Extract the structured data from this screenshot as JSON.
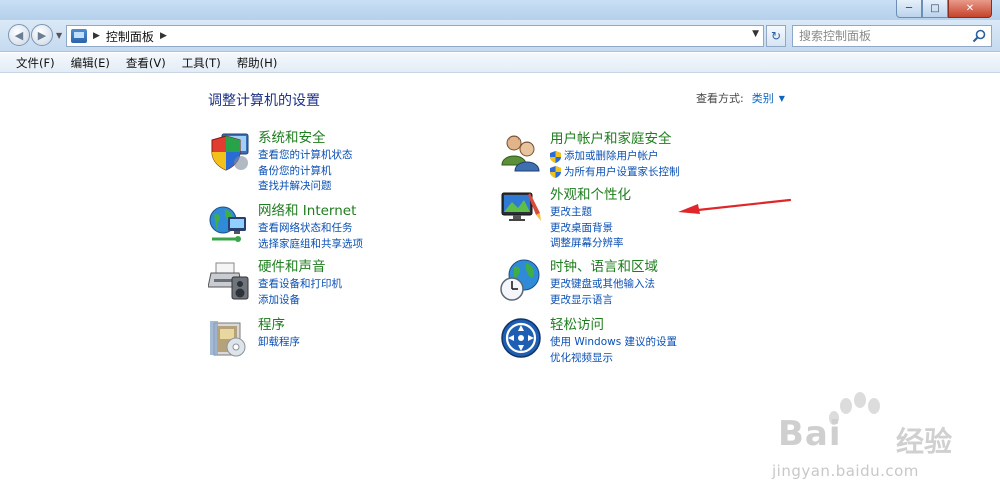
{
  "window": {
    "controls": [
      "minimize-icon",
      "restore-icon",
      "close-icon"
    ]
  },
  "address": {
    "path": "控制面板",
    "search_placeholder": "搜索控制面板"
  },
  "menu": [
    "文件(F)",
    "编辑(E)",
    "查看(V)",
    "工具(T)",
    "帮助(H)"
  ],
  "main": {
    "title": "调整计算机的设置",
    "view_by_label": "查看方式:",
    "view_by_value": "类别"
  },
  "categories_left": [
    {
      "title": "系统和安全",
      "icon": "shield-computer-icon",
      "links": [
        "查看您的计算机状态",
        "备份您的计算机",
        "查找并解决问题"
      ]
    },
    {
      "title": "网络和 Internet",
      "icon": "network-globe-icon",
      "links": [
        "查看网络状态和任务",
        "选择家庭组和共享选项"
      ]
    },
    {
      "title": "硬件和声音",
      "icon": "printer-speaker-icon",
      "links": [
        "查看设备和打印机",
        "添加设备"
      ]
    },
    {
      "title": "程序",
      "icon": "programs-box-icon",
      "links": [
        "卸载程序"
      ]
    }
  ],
  "categories_right": [
    {
      "title": "用户帐户和家庭安全",
      "icon": "users-icon",
      "links": [
        "添加或删除用户帐户",
        "为所有用户设置家长控制"
      ]
    },
    {
      "title": "外观和个性化",
      "icon": "monitor-brush-icon",
      "links": [
        "更改主题",
        "更改桌面背景",
        "调整屏幕分辨率"
      ]
    },
    {
      "title": "时钟、语言和区域",
      "icon": "globe-clock-icon",
      "links": [
        "更改键盘或其他输入法",
        "更改显示语言"
      ]
    },
    {
      "title": "轻松访问",
      "icon": "ease-of-access-icon",
      "links": [
        "使用 Windows 建议的设置",
        "优化视频显示"
      ]
    }
  ],
  "watermark": {
    "brand": "Bai",
    "brand_cn": "经验",
    "url": "jingyan.baidu.com"
  },
  "colors": {
    "category_title": "#1e7d1e",
    "link": "#0a4fb4",
    "page_title": "#1e3287",
    "annotation_arrow": "#e0262a"
  }
}
